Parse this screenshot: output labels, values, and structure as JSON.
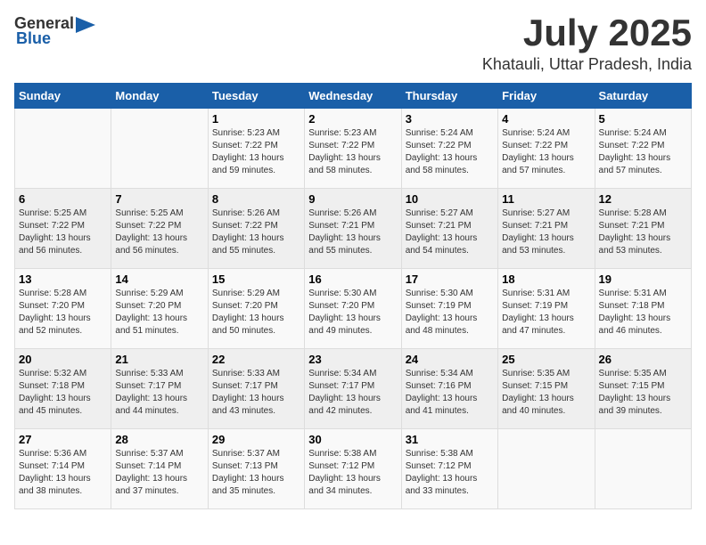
{
  "header": {
    "logo_general": "General",
    "logo_blue": "Blue",
    "month": "July 2025",
    "location": "Khatauli, Uttar Pradesh, India"
  },
  "weekdays": [
    "Sunday",
    "Monday",
    "Tuesday",
    "Wednesday",
    "Thursday",
    "Friday",
    "Saturday"
  ],
  "weeks": [
    [
      {
        "day": "",
        "sunrise": "",
        "sunset": "",
        "daylight": ""
      },
      {
        "day": "",
        "sunrise": "",
        "sunset": "",
        "daylight": ""
      },
      {
        "day": "1",
        "sunrise": "Sunrise: 5:23 AM",
        "sunset": "Sunset: 7:22 PM",
        "daylight": "Daylight: 13 hours and 59 minutes."
      },
      {
        "day": "2",
        "sunrise": "Sunrise: 5:23 AM",
        "sunset": "Sunset: 7:22 PM",
        "daylight": "Daylight: 13 hours and 58 minutes."
      },
      {
        "day": "3",
        "sunrise": "Sunrise: 5:24 AM",
        "sunset": "Sunset: 7:22 PM",
        "daylight": "Daylight: 13 hours and 58 minutes."
      },
      {
        "day": "4",
        "sunrise": "Sunrise: 5:24 AM",
        "sunset": "Sunset: 7:22 PM",
        "daylight": "Daylight: 13 hours and 57 minutes."
      },
      {
        "day": "5",
        "sunrise": "Sunrise: 5:24 AM",
        "sunset": "Sunset: 7:22 PM",
        "daylight": "Daylight: 13 hours and 57 minutes."
      }
    ],
    [
      {
        "day": "6",
        "sunrise": "Sunrise: 5:25 AM",
        "sunset": "Sunset: 7:22 PM",
        "daylight": "Daylight: 13 hours and 56 minutes."
      },
      {
        "day": "7",
        "sunrise": "Sunrise: 5:25 AM",
        "sunset": "Sunset: 7:22 PM",
        "daylight": "Daylight: 13 hours and 56 minutes."
      },
      {
        "day": "8",
        "sunrise": "Sunrise: 5:26 AM",
        "sunset": "Sunset: 7:22 PM",
        "daylight": "Daylight: 13 hours and 55 minutes."
      },
      {
        "day": "9",
        "sunrise": "Sunrise: 5:26 AM",
        "sunset": "Sunset: 7:21 PM",
        "daylight": "Daylight: 13 hours and 55 minutes."
      },
      {
        "day": "10",
        "sunrise": "Sunrise: 5:27 AM",
        "sunset": "Sunset: 7:21 PM",
        "daylight": "Daylight: 13 hours and 54 minutes."
      },
      {
        "day": "11",
        "sunrise": "Sunrise: 5:27 AM",
        "sunset": "Sunset: 7:21 PM",
        "daylight": "Daylight: 13 hours and 53 minutes."
      },
      {
        "day": "12",
        "sunrise": "Sunrise: 5:28 AM",
        "sunset": "Sunset: 7:21 PM",
        "daylight": "Daylight: 13 hours and 53 minutes."
      }
    ],
    [
      {
        "day": "13",
        "sunrise": "Sunrise: 5:28 AM",
        "sunset": "Sunset: 7:20 PM",
        "daylight": "Daylight: 13 hours and 52 minutes."
      },
      {
        "day": "14",
        "sunrise": "Sunrise: 5:29 AM",
        "sunset": "Sunset: 7:20 PM",
        "daylight": "Daylight: 13 hours and 51 minutes."
      },
      {
        "day": "15",
        "sunrise": "Sunrise: 5:29 AM",
        "sunset": "Sunset: 7:20 PM",
        "daylight": "Daylight: 13 hours and 50 minutes."
      },
      {
        "day": "16",
        "sunrise": "Sunrise: 5:30 AM",
        "sunset": "Sunset: 7:20 PM",
        "daylight": "Daylight: 13 hours and 49 minutes."
      },
      {
        "day": "17",
        "sunrise": "Sunrise: 5:30 AM",
        "sunset": "Sunset: 7:19 PM",
        "daylight": "Daylight: 13 hours and 48 minutes."
      },
      {
        "day": "18",
        "sunrise": "Sunrise: 5:31 AM",
        "sunset": "Sunset: 7:19 PM",
        "daylight": "Daylight: 13 hours and 47 minutes."
      },
      {
        "day": "19",
        "sunrise": "Sunrise: 5:31 AM",
        "sunset": "Sunset: 7:18 PM",
        "daylight": "Daylight: 13 hours and 46 minutes."
      }
    ],
    [
      {
        "day": "20",
        "sunrise": "Sunrise: 5:32 AM",
        "sunset": "Sunset: 7:18 PM",
        "daylight": "Daylight: 13 hours and 45 minutes."
      },
      {
        "day": "21",
        "sunrise": "Sunrise: 5:33 AM",
        "sunset": "Sunset: 7:17 PM",
        "daylight": "Daylight: 13 hours and 44 minutes."
      },
      {
        "day": "22",
        "sunrise": "Sunrise: 5:33 AM",
        "sunset": "Sunset: 7:17 PM",
        "daylight": "Daylight: 13 hours and 43 minutes."
      },
      {
        "day": "23",
        "sunrise": "Sunrise: 5:34 AM",
        "sunset": "Sunset: 7:17 PM",
        "daylight": "Daylight: 13 hours and 42 minutes."
      },
      {
        "day": "24",
        "sunrise": "Sunrise: 5:34 AM",
        "sunset": "Sunset: 7:16 PM",
        "daylight": "Daylight: 13 hours and 41 minutes."
      },
      {
        "day": "25",
        "sunrise": "Sunrise: 5:35 AM",
        "sunset": "Sunset: 7:15 PM",
        "daylight": "Daylight: 13 hours and 40 minutes."
      },
      {
        "day": "26",
        "sunrise": "Sunrise: 5:35 AM",
        "sunset": "Sunset: 7:15 PM",
        "daylight": "Daylight: 13 hours and 39 minutes."
      }
    ],
    [
      {
        "day": "27",
        "sunrise": "Sunrise: 5:36 AM",
        "sunset": "Sunset: 7:14 PM",
        "daylight": "Daylight: 13 hours and 38 minutes."
      },
      {
        "day": "28",
        "sunrise": "Sunrise: 5:37 AM",
        "sunset": "Sunset: 7:14 PM",
        "daylight": "Daylight: 13 hours and 37 minutes."
      },
      {
        "day": "29",
        "sunrise": "Sunrise: 5:37 AM",
        "sunset": "Sunset: 7:13 PM",
        "daylight": "Daylight: 13 hours and 35 minutes."
      },
      {
        "day": "30",
        "sunrise": "Sunrise: 5:38 AM",
        "sunset": "Sunset: 7:12 PM",
        "daylight": "Daylight: 13 hours and 34 minutes."
      },
      {
        "day": "31",
        "sunrise": "Sunrise: 5:38 AM",
        "sunset": "Sunset: 7:12 PM",
        "daylight": "Daylight: 13 hours and 33 minutes."
      },
      {
        "day": "",
        "sunrise": "",
        "sunset": "",
        "daylight": ""
      },
      {
        "day": "",
        "sunrise": "",
        "sunset": "",
        "daylight": ""
      }
    ]
  ]
}
